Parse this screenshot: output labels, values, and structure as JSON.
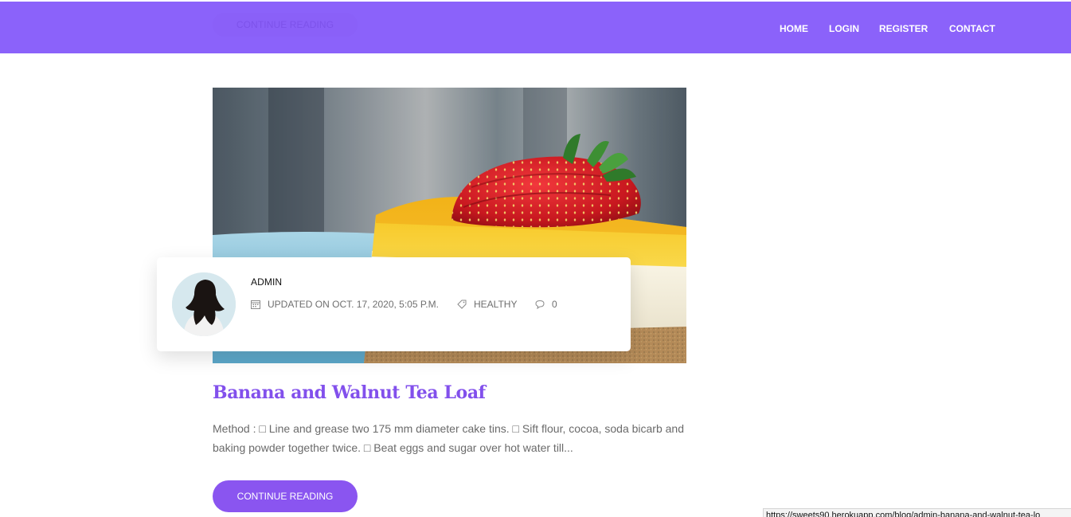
{
  "header": {
    "ghost_button_label": "CONTINUE READING",
    "nav": [
      "HOME",
      "LOGIN",
      "REGISTER",
      "CONTACT"
    ],
    "background_color": "#8b62fa"
  },
  "post": {
    "author": "ADMIN",
    "updated": "UPDATED ON OCT. 17, 2020, 5:05 P.M.",
    "category": "HEALTHY",
    "comments": "0",
    "title": "Banana and Walnut Tea Loaf",
    "excerpt": "Method : □ Line and grease two 175 mm diameter cake tins. □ Sift flour, cocoa, soda bicarb and baking powder together twice. □ Beat eggs and sugar over hot water till...",
    "button_label": "CONTINUE READING",
    "icons": [
      "calendar-icon",
      "tag-icon",
      "comment-icon"
    ],
    "accent_color": "#8250ec"
  },
  "status_bar": {
    "url": "https://sweets90.herokuapp.com/blog/admin-banana-and-walnut-tea-lo"
  }
}
